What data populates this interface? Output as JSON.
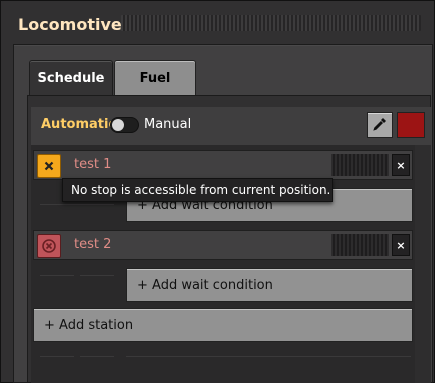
{
  "window": {
    "title": "Locomotive"
  },
  "tabs": [
    {
      "label": "Schedule",
      "active": true
    },
    {
      "label": "Fuel",
      "active": false
    }
  ],
  "mode": {
    "automatic_label": "Automatic",
    "manual_label": "Manual",
    "selected": "Automatic"
  },
  "color_swatch": "#9c1414",
  "stations": [
    {
      "name": "test 1",
      "status_icon": "warning-x-icon",
      "status_color": "#f4a81c",
      "remove_label": "×"
    },
    {
      "name": "test 2",
      "status_icon": "error-circle-icon",
      "status_color": "#c0545a",
      "remove_label": "×"
    }
  ],
  "tooltip": {
    "text": "No stop is accessible from current position."
  },
  "buttons": {
    "add_wait_condition": "+ Add wait condition",
    "add_station": "+ Add station"
  }
}
